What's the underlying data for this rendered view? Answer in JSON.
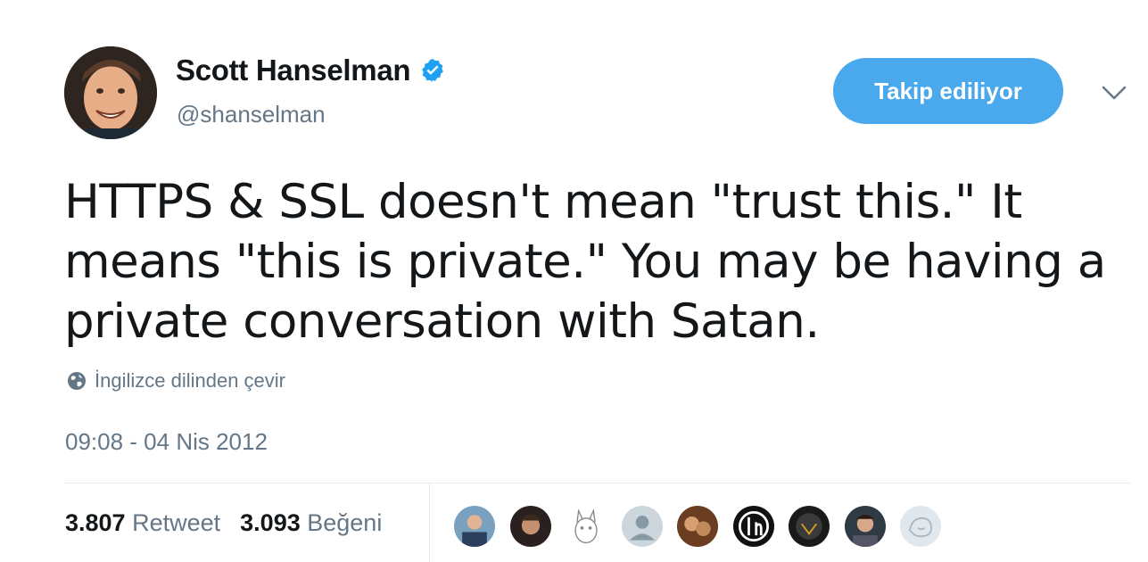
{
  "author": {
    "name": "Scott Hanselman",
    "handle": "@shanselman",
    "verified_icon": "verified-badge-icon"
  },
  "follow_button": {
    "label": "Takip ediliyor"
  },
  "menu": {
    "icon": "chevron-down-icon"
  },
  "tweet": {
    "text": "HTTPS & SSL doesn't mean \"trust this.\" It means \"this is private.\" You may be having a private conversation with Satan."
  },
  "translate": {
    "label": "İngilizce dilinden çevir",
    "icon": "globe-icon"
  },
  "timestamp": "09:08 - 04 Nis 2012",
  "stats": {
    "retweets_count": "3.807",
    "retweets_label": "Retweet",
    "likes_count": "3.093",
    "likes_label": "Beğeni"
  },
  "colors": {
    "accent": "#4aa8ec",
    "muted": "#657786",
    "text": "#14171a"
  }
}
